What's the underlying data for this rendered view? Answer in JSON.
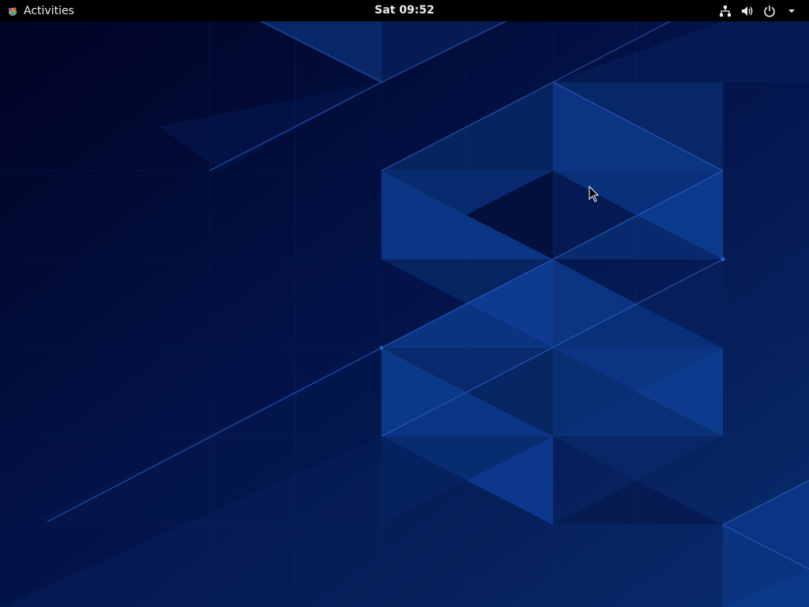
{
  "topbar": {
    "activities_label": "Activities",
    "clock": "Sat 09:52",
    "icons": [
      "network-icon",
      "volume-icon",
      "power-icon",
      "menu-arrow-icon"
    ]
  },
  "colors": {
    "topbar_bg": "#000000",
    "topbar_text": "#eeeeec",
    "wallpaper_dark": "#020a2a",
    "wallpaper_mid": "#0b2b6b",
    "wallpaper_light": "#1a4fa8"
  }
}
